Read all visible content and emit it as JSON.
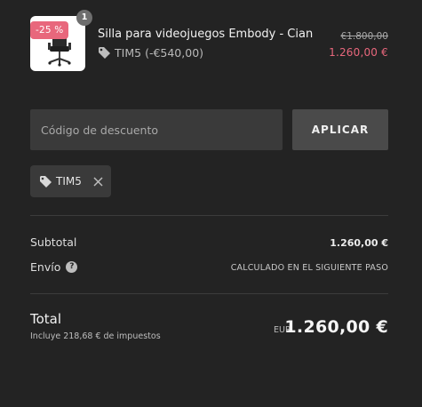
{
  "product": {
    "name": "Silla para videojuegos Embody - Cian",
    "discount_badge": "-25 %",
    "quantity": "1",
    "discount_code": "TIM5",
    "discount_amount": "(-€540,00)",
    "price_original": "€1.800,00",
    "price_final": "1.260,00 €",
    "image_icon": "office-chair-icon"
  },
  "discount_form": {
    "placeholder": "Código de descuento",
    "value": "",
    "apply_label": "APLICAR"
  },
  "applied_code": {
    "code": "TIM5",
    "remove_icon": "close-icon"
  },
  "summary": {
    "subtotal_label": "Subtotal",
    "subtotal_value": "1.260,00 €",
    "shipping_label": "Envío",
    "shipping_value": "CALCULADO EN EL SIGUIENTE PASO",
    "help_glyph": "?"
  },
  "total": {
    "label": "Total",
    "tax_note": "Incluye 218,68 € de impuestos",
    "currency": "EUR",
    "amount": "1.260,00 €"
  },
  "colors": {
    "background": "#232323",
    "accent_discount": "#e8677c",
    "input_bg": "#3a3a3a",
    "button_bg": "#4a4a4a"
  }
}
